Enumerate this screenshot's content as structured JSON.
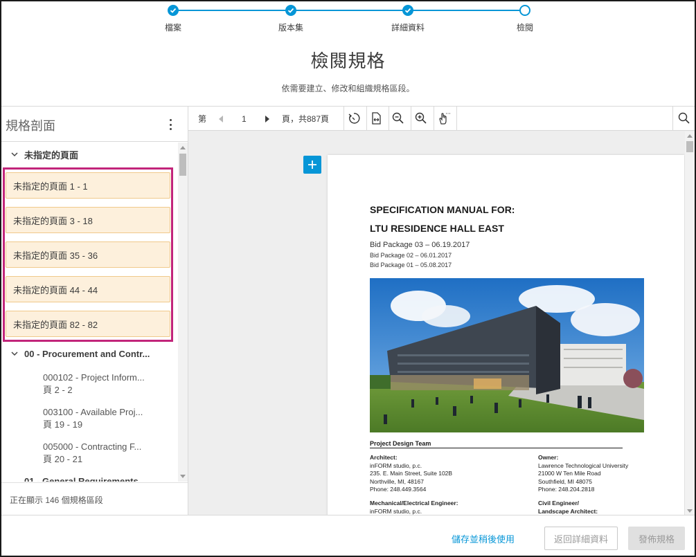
{
  "stepper": {
    "steps": [
      {
        "label": "檔案",
        "state": "done"
      },
      {
        "label": "版本集",
        "state": "done"
      },
      {
        "label": "詳細資料",
        "state": "done"
      },
      {
        "label": "檢閱",
        "state": "current"
      }
    ]
  },
  "header": {
    "title": "檢閱規格",
    "subtitle": "依需要建立、修改和組織規格區段。"
  },
  "left_panel": {
    "title": "規格剖面",
    "unassigned_group": "未指定的頁面",
    "unassigned_pages": [
      "未指定的頁面 1 - 1",
      "未指定的頁面 3 - 18",
      "未指定的頁面 35 - 36",
      "未指定的頁面 44 - 44",
      "未指定的頁面 82 - 82"
    ],
    "group_00": "00 - Procurement and Contr...",
    "sections": [
      {
        "name": "000102 - Project Inform...",
        "pages": "頁 2 - 2"
      },
      {
        "name": "003100 - Available Proj...",
        "pages": "頁 19 - 19"
      },
      {
        "name": "005000 - Contracting F...",
        "pages": "頁 20 - 21"
      }
    ],
    "group_01_partial": "01 - General Requirements",
    "footer": "正在顯示 146 個規格區段"
  },
  "toolbar": {
    "page_prefix": "第",
    "page_number": "1",
    "page_suffix": "頁，共887頁"
  },
  "document": {
    "title_line1": "SPECIFICATION MANUAL FOR:",
    "title_line2": "LTU RESIDENCE HALL EAST",
    "bid_main": "Bid Package 03 – 06.19.2017",
    "bid_2": "Bid Package 02 – 06.01.2017",
    "bid_1": "Bid Package 01 – 05.08.2017",
    "team_heading": "Project Design Team",
    "architect": {
      "role": "Architect:",
      "lines": [
        "inFORM studio, p.c.",
        "235. E. Main Street, Suite 102B",
        "Northville, MI, 48167",
        "Phone: 248.449.3564"
      ]
    },
    "owner": {
      "role": "Owner:",
      "lines": [
        "Lawrence Technological University",
        "21000 W Ten Mile Road",
        "Southfield, MI 48075",
        "Phone: 248.204.2818"
      ]
    },
    "mep": {
      "role": "Mechanical/Electrical Engineer:",
      "lines": [
        "inFORM studio, p.c."
      ]
    },
    "civil": {
      "role": "Civil Engineer/",
      "lines": [
        "Landscape Architect:"
      ]
    }
  },
  "footer_buttons": {
    "save_later": "儲存並稍後使用",
    "back": "返回詳細資料",
    "publish": "發佈規格"
  },
  "colors": {
    "accent": "#0696d7",
    "highlight_border": "#c2257a",
    "card_bg": "#fdf0dc"
  }
}
